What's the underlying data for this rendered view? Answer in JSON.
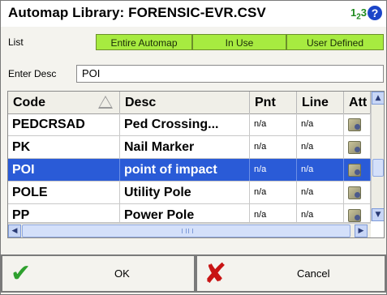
{
  "window": {
    "title": "Automap Library: FORENSIC-EVR.CSV",
    "number_icon_text": "1",
    "number_icon_sub": "2",
    "number_icon_tail": "3",
    "help_icon": "?"
  },
  "filter": {
    "label": "List",
    "buttons": [
      "Entire Automap",
      "In Use",
      "User Defined"
    ]
  },
  "description": {
    "label": "Enter Desc",
    "value": "POI"
  },
  "table": {
    "columns": [
      "Code",
      "Desc",
      "Pnt",
      "Line",
      "Att"
    ],
    "rows": [
      {
        "code": "PEDCRSAD",
        "desc": "Ped Crossing...",
        "pnt": "n/a",
        "line": "n/a",
        "att_icon": "attribute-icon"
      },
      {
        "code": "PK",
        "desc": "Nail Marker",
        "pnt": "n/a",
        "line": "n/a",
        "att_icon": "attribute-icon"
      },
      {
        "code": "POI",
        "desc": "point of impact",
        "pnt": "n/a",
        "line": "n/a",
        "att_icon": "attribute-icon",
        "selected": true
      },
      {
        "code": "POLE",
        "desc": "Utility Pole",
        "pnt": "n/a",
        "line": "n/a",
        "att_icon": "attribute-icon"
      },
      {
        "code": "PP",
        "desc": "Power Pole",
        "pnt": "n/a",
        "line": "n/a",
        "att_icon": "attribute-icon"
      }
    ]
  },
  "footer": {
    "ok_label": "OK",
    "cancel_label": "Cancel"
  },
  "colors": {
    "filter_button": "#a7eb40",
    "selection": "#2a5bd7",
    "ok_check": "#2ea02e",
    "cancel_x": "#c81414",
    "help_icon": "#1b45c8",
    "number_icon": "#1f8a1f"
  }
}
